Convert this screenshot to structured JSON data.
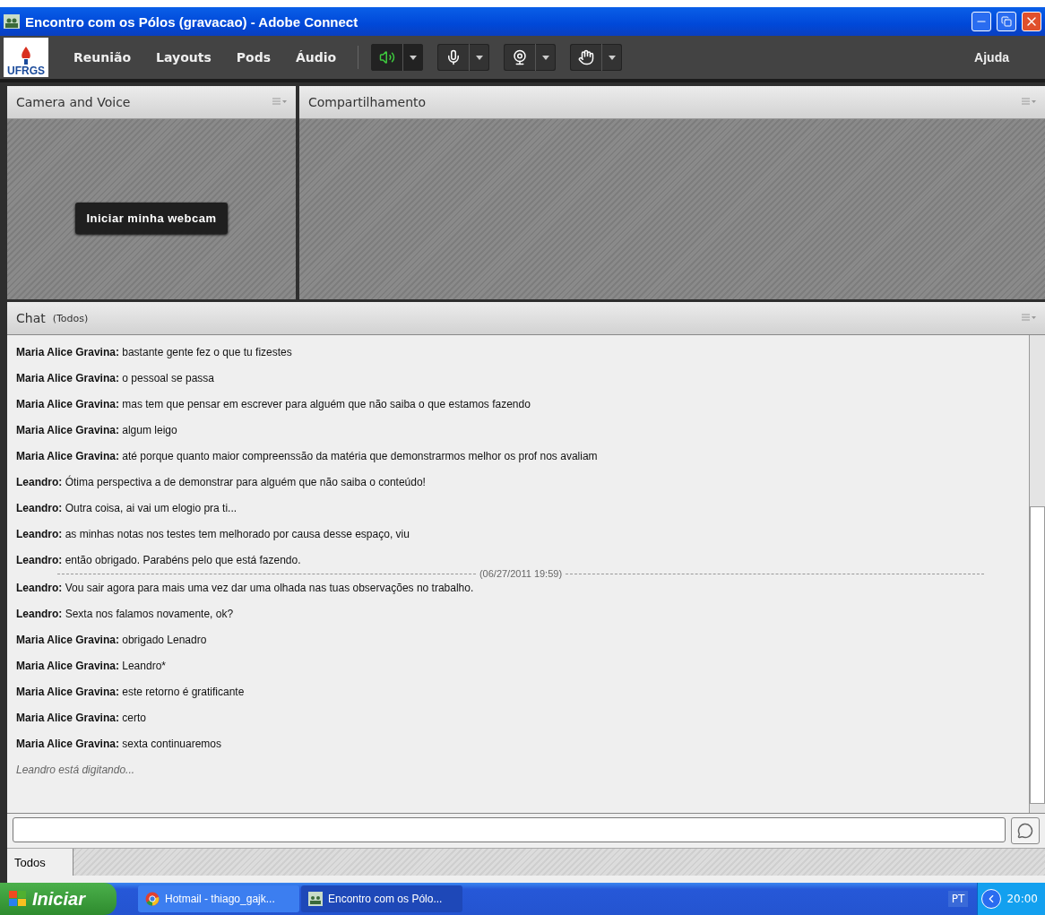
{
  "window": {
    "title": "Encontro com os Pólos (gravacao) - Adobe Connect"
  },
  "toolbar": {
    "logo": "UFRGS",
    "menus": [
      "Reunião",
      "Layouts",
      "Pods",
      "Áudio"
    ],
    "devices": [
      {
        "kind": "speaker",
        "on": true
      },
      {
        "kind": "mic",
        "on": false
      },
      {
        "kind": "camera",
        "on": false
      },
      {
        "kind": "hand",
        "on": false
      }
    ],
    "help": "Ajuda"
  },
  "pods": {
    "camera": {
      "title": "Camera and Voice",
      "button": "Iniciar minha webcam"
    },
    "share": {
      "title": "Compartilhamento"
    }
  },
  "chat": {
    "title": "Chat",
    "scope": "(Todos)",
    "messages": [
      {
        "kind": "message",
        "text": "**Maria Alice Gravina:** bastante gente fez o que tu fizestes"
      },
      {
        "kind": "message",
        "text": "**Maria Alice Gravina:** o pessoal se passa"
      },
      {
        "kind": "message",
        "text": "**Maria Alice Gravina:** mas tem que pensar em escrever para alguém que não saiba o que estamos fazendo"
      },
      {
        "kind": "message",
        "text": "**Maria Alice Gravina:** algum leigo"
      },
      {
        "kind": "message",
        "text": "**Maria Alice Gravina:** até porque quanto maior compreenssão da matéria que demonstrarmos melhor os prof nos avaliam"
      },
      {
        "kind": "message",
        "text": "**Leandro:** Ótima perspectiva a de demonstrar para alguém que não saiba o conteúdo!"
      },
      {
        "kind": "message",
        "text": "**Leandro:** Outra coisa, ai vai um elogio pra ti..."
      },
      {
        "kind": "message",
        "text": "**Leandro:** as minhas notas nos testes tem melhorado por causa desse espaço, viu"
      },
      {
        "kind": "message",
        "text": "**Leandro:** então obrigado. Parabéns pelo que está fazendo."
      },
      {
        "kind": "divider",
        "text": "(06/27/2011 19:59)"
      },
      {
        "kind": "message",
        "text": "**Leandro:** Vou sair agora para mais uma vez dar uma olhada nas tuas observações no trabalho."
      },
      {
        "kind": "message",
        "text": "**Leandro:** Sexta nos falamos novamente, ok?"
      },
      {
        "kind": "message",
        "text": "**Maria Alice Gravina:** obrigado Lenadro"
      },
      {
        "kind": "message",
        "text": "**Maria Alice Gravina:** Leandro*"
      },
      {
        "kind": "message",
        "text": "**Maria Alice Gravina:** este retorno é gratificante"
      },
      {
        "kind": "message",
        "text": "**Maria Alice Gravina:** certo"
      },
      {
        "kind": "message",
        "text": "**Maria Alice Gravina:** sexta continuaremos"
      },
      {
        "kind": "typing",
        "text": "Leandro está digitando..."
      }
    ],
    "tabs": [
      {
        "label": "Todos",
        "selected": true
      }
    ]
  },
  "taskbar": {
    "start": "Iniciar",
    "tasks": [
      {
        "label": "Hotmail - thiago_gajk...",
        "kind": "browser",
        "selected": false
      },
      {
        "label": "Encontro com os Pólo...",
        "kind": "connect",
        "selected": true
      }
    ],
    "language": "PT",
    "clock": "20:00"
  }
}
